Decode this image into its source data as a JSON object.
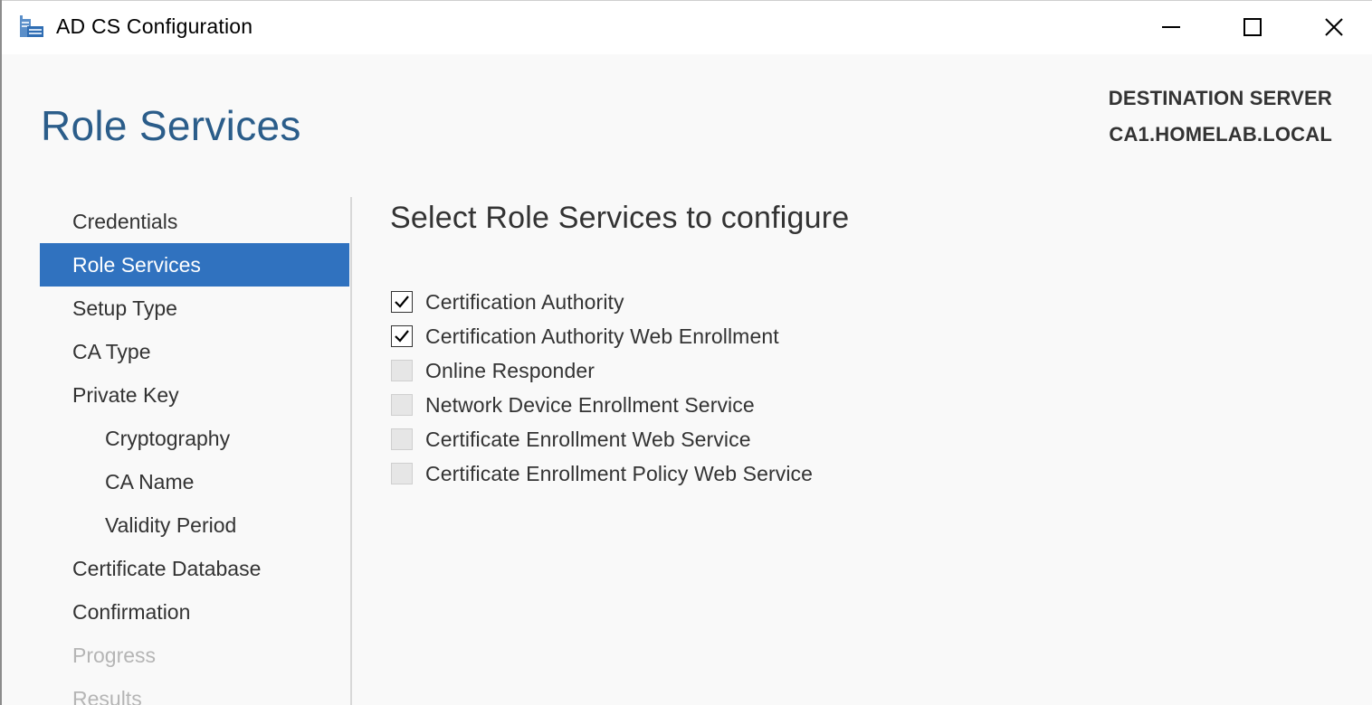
{
  "window": {
    "title": "AD CS Configuration",
    "icon": "server-manager-icon"
  },
  "header": {
    "page_title": "Role Services",
    "destination_label": "DESTINATION SERVER",
    "destination_value": "CA1.HOMELAB.LOCAL"
  },
  "nav": {
    "items": [
      {
        "label": "Credentials",
        "state": "normal",
        "level": 0
      },
      {
        "label": "Role Services",
        "state": "active",
        "level": 0
      },
      {
        "label": "Setup Type",
        "state": "normal",
        "level": 0
      },
      {
        "label": "CA Type",
        "state": "normal",
        "level": 0
      },
      {
        "label": "Private Key",
        "state": "normal",
        "level": 0
      },
      {
        "label": "Cryptography",
        "state": "normal",
        "level": 1
      },
      {
        "label": "CA Name",
        "state": "normal",
        "level": 1
      },
      {
        "label": "Validity Period",
        "state": "normal",
        "level": 1
      },
      {
        "label": "Certificate Database",
        "state": "normal",
        "level": 0
      },
      {
        "label": "Confirmation",
        "state": "normal",
        "level": 0
      },
      {
        "label": "Progress",
        "state": "disabled",
        "level": 0
      },
      {
        "label": "Results",
        "state": "disabled",
        "level": 0
      }
    ]
  },
  "content": {
    "heading": "Select Role Services to configure",
    "roles": [
      {
        "label": "Certification Authority",
        "checked": true,
        "enabled": true
      },
      {
        "label": "Certification Authority Web Enrollment",
        "checked": true,
        "enabled": true
      },
      {
        "label": "Online Responder",
        "checked": false,
        "enabled": false
      },
      {
        "label": "Network Device Enrollment Service",
        "checked": false,
        "enabled": false
      },
      {
        "label": "Certificate Enrollment Web Service",
        "checked": false,
        "enabled": false
      },
      {
        "label": "Certificate Enrollment Policy Web Service",
        "checked": false,
        "enabled": false
      }
    ]
  },
  "colors": {
    "accent": "#3072bf",
    "title_blue": "#2b5d8a",
    "disabled_text": "#b5b5b5"
  }
}
